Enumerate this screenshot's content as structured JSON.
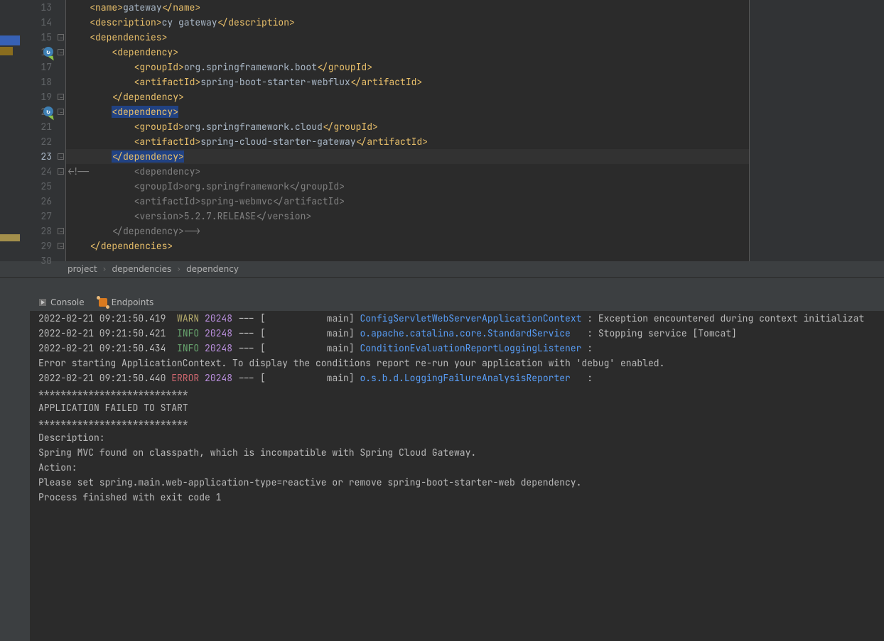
{
  "code_lines": [
    {
      "num": "13",
      "indent": "    ",
      "content": [
        {
          "cls": "tag",
          "t": "<name>"
        },
        {
          "cls": "text",
          "t": "gateway"
        },
        {
          "cls": "tag",
          "t": "</name>"
        }
      ]
    },
    {
      "num": "14",
      "indent": "    ",
      "content": [
        {
          "cls": "tag",
          "t": "<description>"
        },
        {
          "cls": "text",
          "t": "cy gateway"
        },
        {
          "cls": "tag",
          "t": "</description>"
        }
      ]
    },
    {
      "num": "15",
      "indent": "    ",
      "content": [
        {
          "cls": "tag",
          "t": "<dependencies>"
        }
      ]
    },
    {
      "num": "16",
      "indent": "        ",
      "badge": true,
      "content": [
        {
          "cls": "tag",
          "t": "<dependency>"
        }
      ]
    },
    {
      "num": "17",
      "indent": "            ",
      "content": [
        {
          "cls": "tag",
          "t": "<groupId>"
        },
        {
          "cls": "text",
          "t": "org.springframework.boot"
        },
        {
          "cls": "tag",
          "t": "</groupId>"
        }
      ]
    },
    {
      "num": "18",
      "indent": "            ",
      "content": [
        {
          "cls": "tag",
          "t": "<artifactId>"
        },
        {
          "cls": "text",
          "t": "spring-boot-starter-webflux"
        },
        {
          "cls": "tag",
          "t": "</artifactId>"
        }
      ]
    },
    {
      "num": "19",
      "indent": "        ",
      "content": [
        {
          "cls": "tag",
          "t": "</dependency>"
        }
      ]
    },
    {
      "num": "20",
      "indent": "        ",
      "badge": true,
      "sel": true,
      "content": [
        {
          "cls": "tag",
          "t": "<dependency>"
        }
      ]
    },
    {
      "num": "21",
      "indent": "            ",
      "content": [
        {
          "cls": "tag",
          "t": "<groupId>"
        },
        {
          "cls": "text",
          "t": "org.springframework.cloud"
        },
        {
          "cls": "tag",
          "t": "</groupId>"
        }
      ]
    },
    {
      "num": "22",
      "indent": "            ",
      "content": [
        {
          "cls": "tag",
          "t": "<artifactId>"
        },
        {
          "cls": "text",
          "t": "spring-cloud-starter-gateway"
        },
        {
          "cls": "tag",
          "t": "</artifactId>"
        }
      ]
    },
    {
      "num": "23",
      "indent": "        ",
      "current": true,
      "sel": true,
      "content": [
        {
          "cls": "tag",
          "t": "</dependency>"
        }
      ]
    },
    {
      "num": "24",
      "indent": "",
      "content": [
        {
          "cls": "grey",
          "t": "<!--        <dependency>"
        }
      ]
    },
    {
      "num": "25",
      "indent": "",
      "content": [
        {
          "cls": "grey",
          "t": "            <groupId>org.springframework</groupId>"
        }
      ]
    },
    {
      "num": "26",
      "indent": "",
      "content": [
        {
          "cls": "grey",
          "t": "            <artifactId>spring-webmvc</artifactId>"
        }
      ]
    },
    {
      "num": "27",
      "indent": "",
      "content": [
        {
          "cls": "grey",
          "t": "            <version>5.2.7.RELEASE</version>"
        }
      ]
    },
    {
      "num": "28",
      "indent": "",
      "content": [
        {
          "cls": "grey",
          "t": "        </dependency>-->"
        }
      ]
    },
    {
      "num": "29",
      "indent": "    ",
      "content": [
        {
          "cls": "tag",
          "t": "</dependencies>"
        }
      ]
    },
    {
      "num": "30",
      "indent": "",
      "content": []
    }
  ],
  "breadcrumbs": [
    "project",
    "dependencies",
    "dependency"
  ],
  "tabs": {
    "console": "Console",
    "endpoints": "Endpoints"
  },
  "console_lines": [
    {
      "segments": [
        {
          "cls": "white",
          "t": "2022-02-21 09:21:50.419  "
        },
        {
          "cls": "warn",
          "t": "WARN"
        },
        {
          "cls": "white",
          "t": " "
        },
        {
          "cls": "pid",
          "t": "20248"
        },
        {
          "cls": "white",
          "t": " --- [           main] "
        },
        {
          "cls": "cyan",
          "t": "ConfigServletWebServerApplicationContext"
        },
        {
          "cls": "white",
          "t": " : Exception encountered during context initializat"
        }
      ]
    },
    {
      "segments": [
        {
          "cls": "white",
          "t": "2022-02-21 09:21:50.421  "
        },
        {
          "cls": "info",
          "t": "INFO"
        },
        {
          "cls": "white",
          "t": " "
        },
        {
          "cls": "pid",
          "t": "20248"
        },
        {
          "cls": "white",
          "t": " --- [           main] "
        },
        {
          "cls": "cyan",
          "t": "o.apache.catalina.core.StandardService"
        },
        {
          "cls": "white",
          "t": "   : Stopping service [Tomcat]"
        }
      ]
    },
    {
      "segments": [
        {
          "cls": "white",
          "t": "2022-02-21 09:21:50.434  "
        },
        {
          "cls": "info",
          "t": "INFO"
        },
        {
          "cls": "white",
          "t": " "
        },
        {
          "cls": "pid",
          "t": "20248"
        },
        {
          "cls": "white",
          "t": " --- [           main] "
        },
        {
          "cls": "cyan",
          "t": "ConditionEvaluationReportLoggingListener"
        },
        {
          "cls": "white",
          "t": " : "
        }
      ]
    },
    {
      "segments": [
        {
          "cls": "white",
          "t": ""
        }
      ]
    },
    {
      "segments": [
        {
          "cls": "white",
          "t": "Error starting ApplicationContext. To display the conditions report re-run your application with 'debug' enabled."
        }
      ]
    },
    {
      "segments": [
        {
          "cls": "white",
          "t": "2022-02-21 09:21:50.440 "
        },
        {
          "cls": "err",
          "t": "ERROR"
        },
        {
          "cls": "white",
          "t": " "
        },
        {
          "cls": "pid",
          "t": "20248"
        },
        {
          "cls": "white",
          "t": " --- [           main] "
        },
        {
          "cls": "cyan",
          "t": "o.s.b.d.LoggingFailureAnalysisReporter"
        },
        {
          "cls": "white",
          "t": "   : "
        }
      ]
    },
    {
      "segments": [
        {
          "cls": "white",
          "t": ""
        }
      ]
    },
    {
      "segments": [
        {
          "cls": "white",
          "t": "***************************"
        }
      ]
    },
    {
      "segments": [
        {
          "cls": "white",
          "t": "APPLICATION FAILED TO START"
        }
      ]
    },
    {
      "segments": [
        {
          "cls": "white",
          "t": "***************************"
        }
      ]
    },
    {
      "segments": [
        {
          "cls": "white",
          "t": ""
        }
      ]
    },
    {
      "segments": [
        {
          "cls": "white",
          "t": "Description:"
        }
      ]
    },
    {
      "segments": [
        {
          "cls": "white",
          "t": ""
        }
      ]
    },
    {
      "segments": [
        {
          "cls": "white",
          "t": "Spring MVC found on classpath, which is incompatible with Spring Cloud Gateway."
        }
      ]
    },
    {
      "segments": [
        {
          "cls": "white",
          "t": ""
        }
      ]
    },
    {
      "segments": [
        {
          "cls": "white",
          "t": "Action:"
        }
      ]
    },
    {
      "segments": [
        {
          "cls": "white",
          "t": ""
        }
      ]
    },
    {
      "segments": [
        {
          "cls": "white",
          "t": "Please set spring.main.web-application-type=reactive or remove spring-boot-starter-web dependency."
        }
      ]
    },
    {
      "segments": [
        {
          "cls": "white",
          "t": ""
        }
      ]
    },
    {
      "segments": [
        {
          "cls": "white",
          "t": ""
        }
      ]
    },
    {
      "segments": [
        {
          "cls": "white",
          "t": "Process finished with exit code 1"
        }
      ]
    }
  ]
}
